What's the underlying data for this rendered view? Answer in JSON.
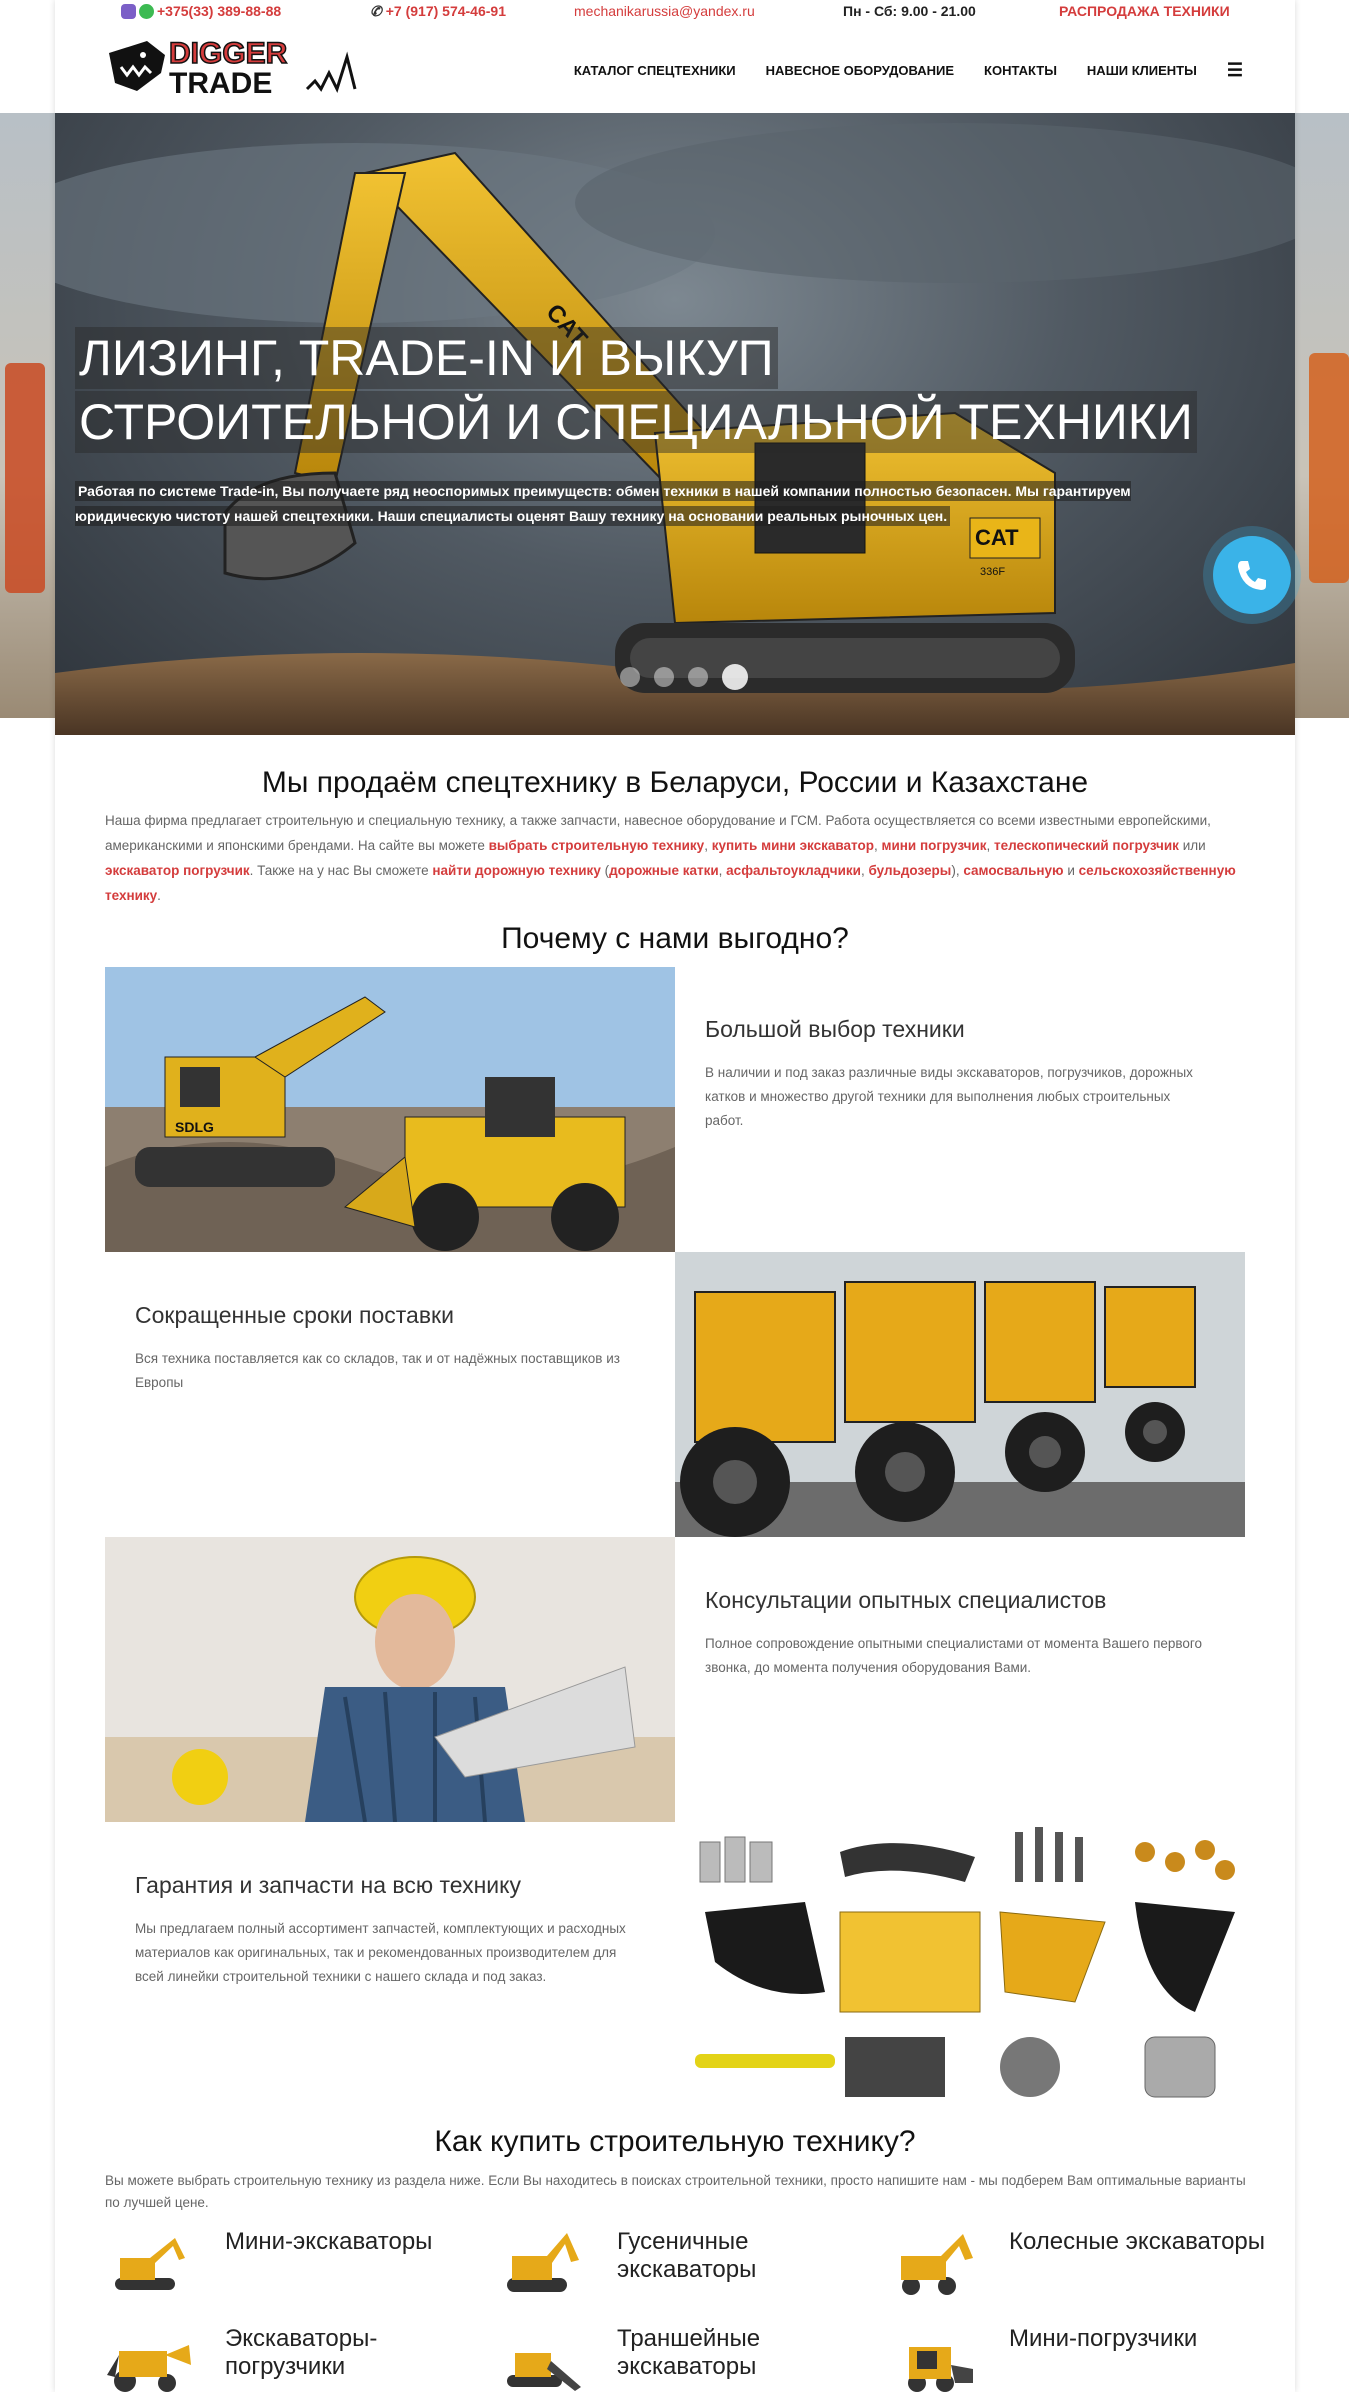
{
  "topbar": {
    "phone1": "+375(33) 389-88-88",
    "phone2": "+7 (917) 574-46-91",
    "email": "mechanikarussia@yandex.ru",
    "hours": "Пн - Сб: 9.00 - 21.00",
    "sale": "РАСПРОДАЖА ТЕХНИКИ"
  },
  "logo": {
    "line1": "DIGGER",
    "line2": "TRADE"
  },
  "nav": {
    "items": [
      "КАТАЛОГ СПЕЦТЕХНИКИ",
      "НАВЕСНОЕ ОБОРУДОВАНИЕ",
      "КОНТАКТЫ",
      "НАШИ КЛИЕНТЫ"
    ],
    "menu_icon": "bars-icon"
  },
  "hero": {
    "title_line1": "ЛИЗИНГ, TRADE-IN И ВЫКУП",
    "title_line2": "СТРОИТЕЛЬНОЙ И СПЕЦИАЛЬНОЙ ТЕХНИКИ",
    "subtitle": "Работая по системе Trade-in, Вы получаете ряд неоспоримых преимуществ: обмен техники в нашей компании полностью безопасен. Мы гарантируем юридическую чистоту нашей спецтехники. Наши специалисты оценят Вашу технику на основании реальных рыночных цен.",
    "excavator_brand": "CAT",
    "excavator_model": "336F",
    "slides": 4,
    "active_slide": 4
  },
  "intro": {
    "heading": "Мы продаём спецтехнику в Беларуси, России и Казахстане",
    "t1": "Наша фирма предлагает строительную и специальную технику, а также запчасти, навесное оборудование и ГСМ. Работа осуществляется со всеми известными европейскими, американскими и японскими брендами. На сайте вы можете ",
    "l1": "выбрать строительную технику",
    "t2": ", ",
    "l2": "купить мини экскаватор",
    "t3": ", ",
    "l3": "мини погрузчик",
    "t4": ", ",
    "l4": "телескопический погрузчик",
    "t5": " или ",
    "l5": "экскаватор погрузчик",
    "t6": ". Также на у нас Вы сможете ",
    "l6": "найти дорожную технику",
    "t7": " (",
    "l7": "дорожные катки",
    "t8": ", ",
    "l8": "асфальтоукладчики",
    "t9": ", ",
    "l9": "бульдозеры",
    "t10": "), ",
    "l10": "самосвальную",
    "t11": " и ",
    "l11": "сельскохозяйственную технику",
    "t12": "."
  },
  "why": {
    "heading": "Почему с нами выгодно?",
    "items": [
      {
        "title": "Большой выбор техники",
        "text": "В наличии и под заказ различные виды экскаваторов, погрузчиков, дорожных катков и множество другой техники для выполнения любых строительных работ."
      },
      {
        "title": "Сокращенные сроки поставки",
        "text": "Вся техника поставляется как со складов, так и от надёжных поставщиков из Европы"
      },
      {
        "title": "Консультации опытных специалистов",
        "text": "Полное сопровождение опытными специалистами от момента Вашего первого звонка, до момента получения оборудования Вами."
      },
      {
        "title": "Гарантия и запчасти на всю технику",
        "text": "Мы предлагаем полный ассортимент запчастей, комплектующих и расходных материалов как оригинальных, так и рекомендованных производителем для всей линейки строительной техники с нашего склада и под заказ."
      }
    ],
    "image_brand": "SDLG"
  },
  "buy": {
    "heading": "Как купить строительную технику?",
    "text": "Вы можете выбрать строительную технику из раздела ниже. Если Вы находитесь в поисках строительной техники, просто напишите нам - мы подберем Вам оптимальные варианты по лучшей цене.",
    "categories": [
      {
        "label": "Мини-экскаваторы"
      },
      {
        "label": "Гусеничные экскаваторы"
      },
      {
        "label": "Колесные экскаваторы"
      },
      {
        "label": "Экскаваторы-погрузчики"
      },
      {
        "label": "Траншейные экскаваторы"
      },
      {
        "label": "Мини-погрузчики"
      }
    ]
  },
  "colors": {
    "accent": "#d43c3c",
    "machine_yellow": "#e8b418",
    "call_blue": "#3ab3e8"
  }
}
